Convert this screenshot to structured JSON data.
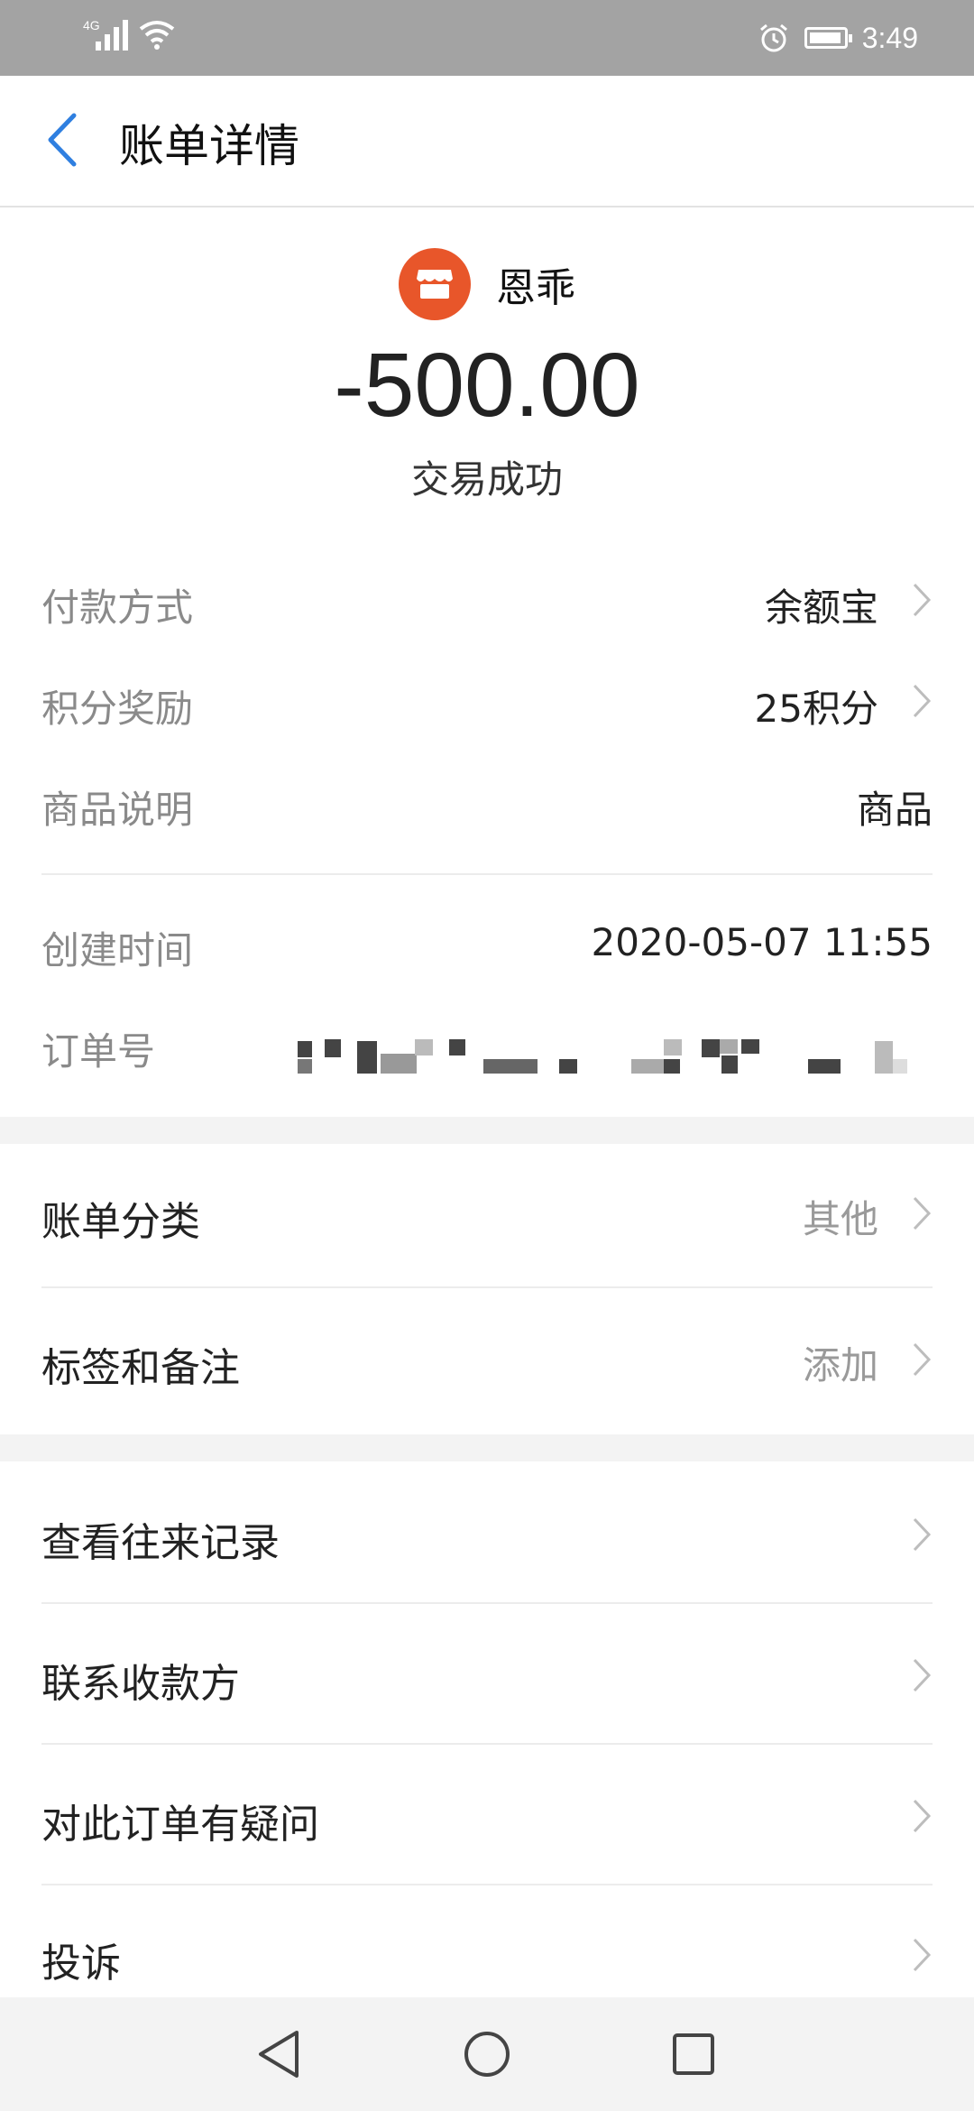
{
  "status_bar": {
    "network": "4G",
    "time": "3:49"
  },
  "header": {
    "title": "账单详情"
  },
  "merchant": {
    "name": "恩乖"
  },
  "transaction": {
    "amount": "-500.00",
    "status": "交易成功"
  },
  "details": [
    {
      "label": "付款方式",
      "value": "余额宝",
      "has_arrow": true
    },
    {
      "label": "积分奖励",
      "value": "25积分",
      "has_arrow": true
    },
    {
      "label": "商品说明",
      "value": "商品",
      "has_arrow": false
    },
    {
      "label": "创建时间",
      "value": "2020-05-07 11:55",
      "has_arrow": false
    },
    {
      "label": "订单号",
      "value": "",
      "has_arrow": false
    }
  ],
  "bill_settings": [
    {
      "label": "账单分类",
      "value": "其他"
    },
    {
      "label": "标签和备注",
      "value": "添加"
    }
  ],
  "actions": [
    {
      "label": "查看往来记录"
    },
    {
      "label": "联系收款方"
    },
    {
      "label": "对此订单有疑问"
    },
    {
      "label": "投诉"
    }
  ],
  "colors": {
    "accent_blue": "#2f7fe0",
    "merchant_orange": "#e8562a",
    "label_gray": "#8a8a8a",
    "status_bar_gray": "#a3a3a3"
  }
}
